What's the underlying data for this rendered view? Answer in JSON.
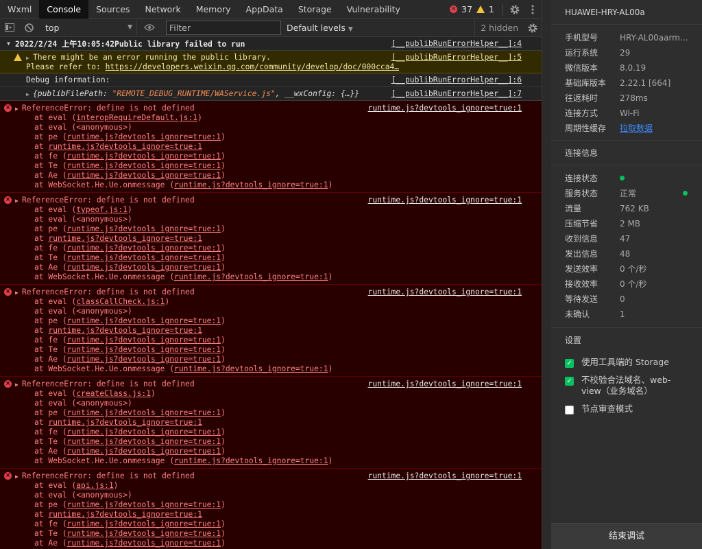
{
  "tabs": [
    "Wxml",
    "Console",
    "Sources",
    "Network",
    "Memory",
    "AppData",
    "Storage",
    "Vulnerability"
  ],
  "active_tab": "Console",
  "counts": {
    "errors": "37",
    "warnings": "1"
  },
  "toolbar": {
    "context": "top",
    "filter_placeholder": "Filter",
    "levels": "Default levels",
    "hidden": "2 hidden"
  },
  "log": {
    "group": {
      "title": "2022/2/24 上午10:05:42Public library failed to run",
      "src": "[__publibRunErrorHelper__]:4"
    },
    "warn": {
      "line1": "There might be an error running the public library.",
      "line2_prefix": "Please refer to: ",
      "link": "https://developers.weixin.qq.com/community/develop/doc/000cca4…",
      "src": "[__publibRunErrorHelper__]:5"
    },
    "debug": {
      "text": "Debug information:",
      "src": "[__publibRunErrorHelper__]:6"
    },
    "obj": {
      "prefix": "{publibFilePath: ",
      "path": "\"REMOTE_DEBUG_RUNTIME/WAService.js\"",
      "suffix": ", __wxConfig: {…}}",
      "src": "[__publibRunErrorHelper__]:7"
    },
    "errors": [
      {
        "title": "ReferenceError: define is not defined",
        "src": "runtime.js?devtools_ignore=true:1",
        "first": "interopRequireDefault.js:1"
      },
      {
        "title": "ReferenceError: define is not defined",
        "src": "runtime.js?devtools_ignore=true:1",
        "first": "typeof.js:1"
      },
      {
        "title": "ReferenceError: define is not defined",
        "src": "runtime.js?devtools_ignore=true:1",
        "first": "classCallCheck.js:1"
      },
      {
        "title": "ReferenceError: define is not defined",
        "src": "runtime.js?devtools_ignore=true:1",
        "first": "createClass.js:1"
      },
      {
        "title": "ReferenceError: define is not defined",
        "src": "runtime.js?devtools_ignore=true:1",
        "first": "api.js:1"
      }
    ],
    "stack": {
      "anonymous": "at eval (<anonymous>)",
      "runtime_link": "runtime.js?devtools_ignore=true:1",
      "fns": [
        "at pe",
        "at fe",
        "at Te",
        "at Ae"
      ],
      "ws": "at WebSocket.He.Ue.onmessage",
      "at_eval": "at eval",
      "at": "at"
    }
  },
  "panel": {
    "device": "HUAWEI-HRY-AL00a",
    "info": [
      {
        "k": "手机型号",
        "v": "HRY-AL00aarm6…"
      },
      {
        "k": "运行系统",
        "v": "29"
      },
      {
        "k": "微信版本",
        "v": "8.0.19"
      },
      {
        "k": "基础库版本",
        "v": "2.22.1 [664]"
      },
      {
        "k": "往返耗时",
        "v": "278ms"
      },
      {
        "k": "连接方式",
        "v": "Wi-Fi"
      },
      {
        "k": "周期性缓存",
        "v": "拉取数据"
      }
    ],
    "conn_heading": "连接信息",
    "conn": [
      {
        "k": "连接状态",
        "v": ""
      },
      {
        "k": "服务状态",
        "v": "正常"
      },
      {
        "k": "流量",
        "v": "762 KB"
      },
      {
        "k": "压缩节省",
        "v": "2 MB"
      },
      {
        "k": "收到信息",
        "v": "47"
      },
      {
        "k": "发出信息",
        "v": "48"
      },
      {
        "k": "发送效率",
        "v": "0 个/秒"
      },
      {
        "k": "接收效率",
        "v": "0 个/秒"
      },
      {
        "k": "等待发送",
        "v": "0"
      },
      {
        "k": "未确认",
        "v": "1"
      }
    ],
    "settings_heading": "设置",
    "settings": [
      {
        "label": "使用工具端的 Storage",
        "checked": true
      },
      {
        "label": "不校验合法域名、web-view（业务域名）",
        "checked": true
      },
      {
        "label": "节点审查模式",
        "checked": false
      }
    ],
    "end_button": "结束调试",
    "status_color": "#07c160"
  }
}
